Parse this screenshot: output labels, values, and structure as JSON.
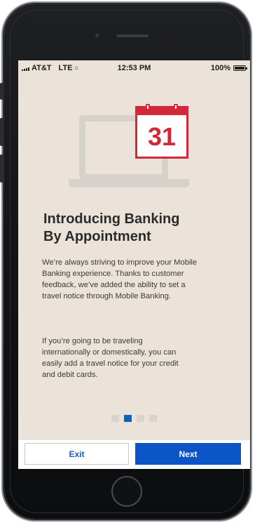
{
  "status_bar": {
    "carrier": "AT&T",
    "network": "LTE",
    "time": "12:53 PM",
    "battery_percent": "100%"
  },
  "hero": {
    "calendar_day": "31"
  },
  "intro": {
    "headline_line1": "Introducing Banking",
    "headline_line2": "By Appointment",
    "paragraph1_lines": [
      "We’re always striving to improve your Mobile",
      "Banking experience. Thanks to customer",
      "feedback, we’ve added the ability to set a",
      "travel notice through Mobile Banking."
    ],
    "paragraph2_lines": [
      "If you’re going to be traveling",
      "internationally or domestically, you can",
      "easily add a travel notice for your credit",
      "and debit cards."
    ]
  },
  "pager": {
    "total": 4,
    "active_index": 1
  },
  "actions": {
    "exit_label": "Exit",
    "next_label": "Next"
  },
  "colors": {
    "accent_blue": "#0b55c8",
    "calendar_red": "#d2283a",
    "screen_background": "#ebe3d9"
  }
}
